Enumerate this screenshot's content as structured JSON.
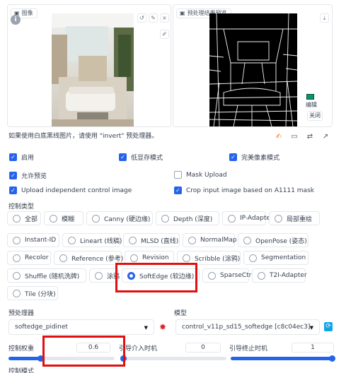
{
  "image_input": {
    "tag_label": "图像",
    "info_symbol": "i",
    "tool_icons": [
      "undo-icon",
      "brush-icon",
      "close-icon",
      "pen-icon"
    ]
  },
  "preview": {
    "tag_label": "预处理结果预览",
    "download_icon": "download-icon",
    "edit_label": "编辑",
    "close_label": "关闭"
  },
  "hint_text": "如果使用白底黑线图片，请使用 \"invert\" 预处理器。",
  "utility_icons": [
    "edit-doc-icon",
    "camera-icon",
    "swap-icon",
    "send-icon"
  ],
  "options": {
    "enable": {
      "label": "启用",
      "checked": true
    },
    "low_vram": {
      "label": "低显存模式",
      "checked": true
    },
    "pixel_perfect": {
      "label": "完美像素模式",
      "checked": true
    },
    "allow_preview": {
      "label": "允许预览",
      "checked": true
    },
    "mask_upload": {
      "label": "Mask Upload",
      "checked": false
    },
    "upload_independent": {
      "label": "Upload independent control image",
      "checked": true
    },
    "crop_input": {
      "label": "Crop input image based on A1111 mask",
      "checked": true
    }
  },
  "control_type": {
    "label": "控制类型",
    "selected": "SoftEdge (软边缘)",
    "items": [
      "全部",
      "模糊",
      "Canny (硬边缘)",
      "Depth (深度)",
      "IP-Adapter",
      "局部重绘",
      "Instant-ID",
      "Lineart (线稿)",
      "MLSD (直线)",
      "NormalMap",
      "OpenPose (姿态)",
      "Recolor",
      "Reference (参考)",
      "Revision",
      "Scribble (涂鸦)",
      "Segmentation",
      "Shuffle (随机洗牌)",
      "涂鸦",
      "SoftEdge (软边缘)",
      "SparseCtrl",
      "T2I-Adapter",
      "Tile (分块)"
    ]
  },
  "preprocessor": {
    "label": "预处理器",
    "value": "softedge_pidinet"
  },
  "model": {
    "label": "模型",
    "value": "control_v11p_sd15_softedge [c8c04ec3]"
  },
  "sliders": {
    "weight": {
      "label": "控制权重",
      "value": "0.6",
      "fraction": 0.3
    },
    "start": {
      "label": "引导介入时机",
      "value": "0",
      "fraction": 0.0
    },
    "end": {
      "label": "引导终止时机",
      "value": "1",
      "fraction": 1.0
    }
  },
  "control_mode_label": "控制模式",
  "colors": {
    "accent": "#2563eb",
    "highlight": "#e01010"
  }
}
